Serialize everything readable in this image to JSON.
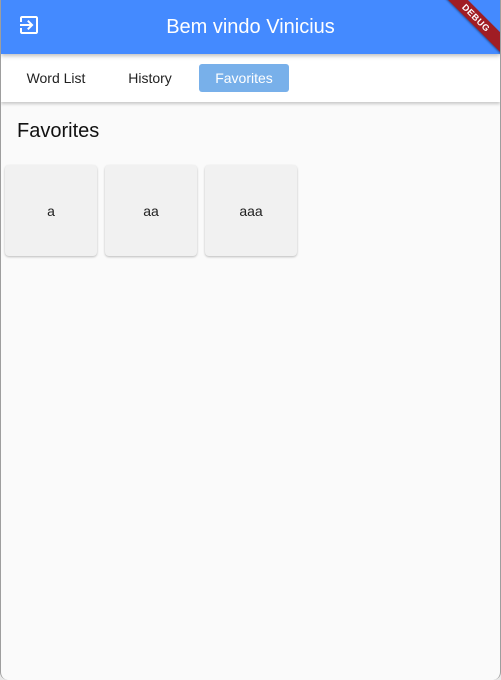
{
  "appbar": {
    "title": "Bem vindo Vinicius",
    "icon": "logout-icon",
    "color": "#448aff"
  },
  "debug_banner": {
    "label": "DEBUG"
  },
  "tabs": [
    {
      "label": "Word List",
      "active": false
    },
    {
      "label": "History",
      "active": false
    },
    {
      "label": "Favorites",
      "active": true
    }
  ],
  "main": {
    "heading": "Favorites",
    "favorites": [
      "a",
      "aa",
      "aaa"
    ]
  }
}
